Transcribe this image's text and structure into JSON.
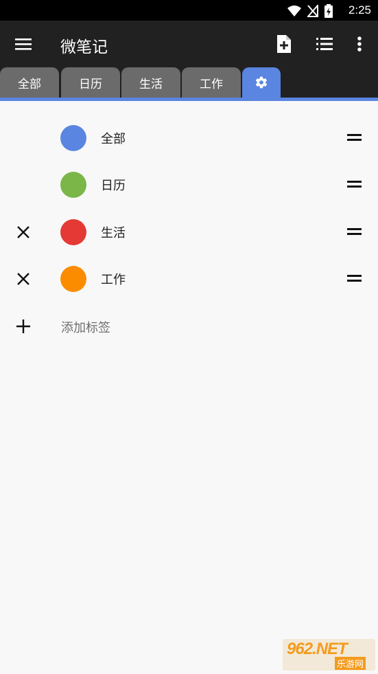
{
  "status_bar": {
    "time": "2:25",
    "icons": [
      "wifi-icon",
      "no-signal-icon",
      "battery-charging-icon"
    ]
  },
  "app_bar": {
    "title": "微笔记",
    "actions": [
      "note-add-icon",
      "list-icon",
      "more-vert-icon"
    ]
  },
  "tabs": [
    {
      "label": "全部"
    },
    {
      "label": "日历"
    },
    {
      "label": "生活"
    },
    {
      "label": "工作"
    },
    {
      "label": "",
      "icon": "settings-icon",
      "active": true
    }
  ],
  "tags": [
    {
      "name": "全部",
      "color": "#5a85e0",
      "deletable": false
    },
    {
      "name": "日历",
      "color": "#7ab648",
      "deletable": false
    },
    {
      "name": "生活",
      "color": "#e53935",
      "deletable": true
    },
    {
      "name": "工作",
      "color": "#fb8c00",
      "deletable": true
    }
  ],
  "add_tag": {
    "label": "添加标签"
  },
  "watermark": {
    "top": "962.NET",
    "bottom": "乐游网"
  },
  "colors": {
    "accent": "#5a85e0",
    "appbar": "#212121",
    "tab_inactive": "#6b6b6b"
  }
}
